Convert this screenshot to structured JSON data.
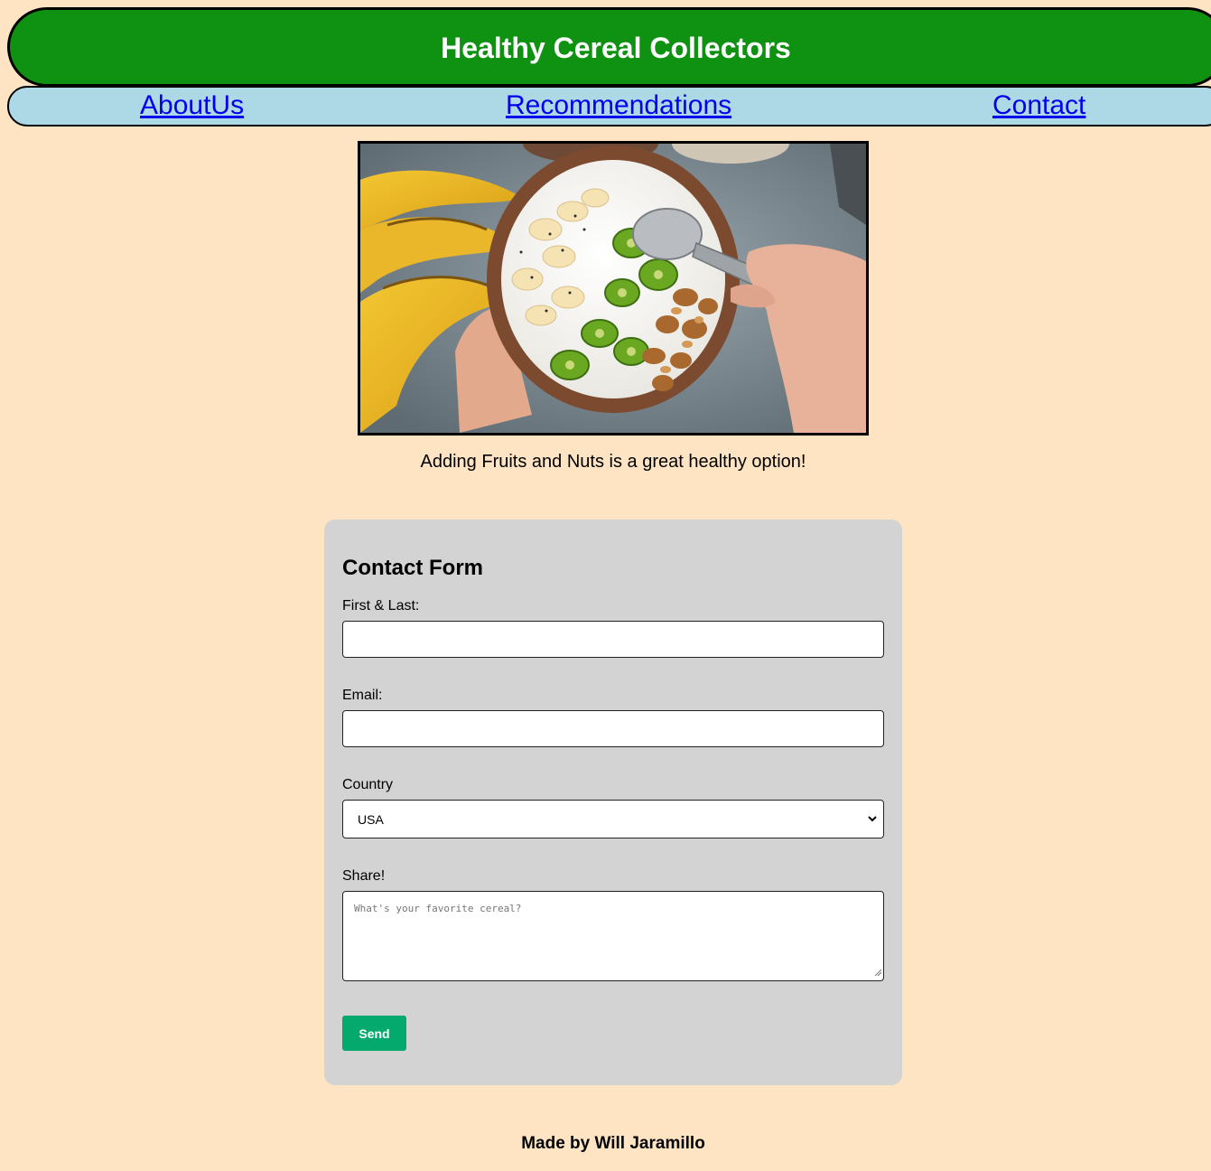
{
  "header": {
    "title": "Healthy Cereal Collectors",
    "background_color": "#0f9211"
  },
  "nav": {
    "background_color": "#add8e6",
    "links": [
      {
        "label": "AboutUs"
      },
      {
        "label": "Recommendations"
      },
      {
        "label": "Contact"
      }
    ]
  },
  "hero": {
    "image_description": "bowl of yogurt with banana, kiwi, granola and chia seeds held in hands beside bananas",
    "caption": "Adding Fruits and Nuts is a great healthy option!"
  },
  "contact_form": {
    "title": "Contact Form",
    "name_label": "First & Last:",
    "name_value": "",
    "email_label": "Email:",
    "email_value": "",
    "country_label": "Country",
    "country_selected": "USA",
    "share_label": "Share!",
    "share_placeholder": "What's your favorite cereal?",
    "send_label": "Send",
    "send_color": "#04aa6d"
  },
  "footer": {
    "credit": "Made by Will Jaramillo"
  },
  "colors": {
    "page_background": "#ffe4c4",
    "form_background": "#d3d3d3",
    "link_color": "#0000ee"
  }
}
